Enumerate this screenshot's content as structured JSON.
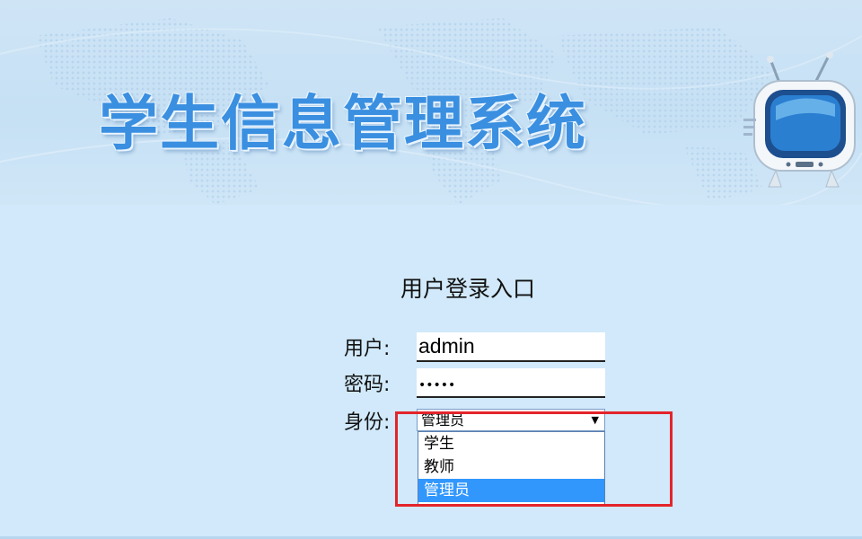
{
  "header": {
    "title": "学生信息管理系统",
    "tv_icon": "tv-icon"
  },
  "login": {
    "title": "用户登录入口",
    "user_label": "用户:",
    "user_value": "admin",
    "password_label": "密码:",
    "password_value": "•••••",
    "role_label": "身份:",
    "role_selected": "管理员",
    "role_options": [
      "学生",
      "教师",
      "管理员"
    ],
    "dropdown_arrow": "▼"
  },
  "colors": {
    "page_bg": "#d1e9fa",
    "title_blue": "#3a8fe0",
    "option_highlight": "#3297fd",
    "annotation_red": "#e3242b"
  }
}
